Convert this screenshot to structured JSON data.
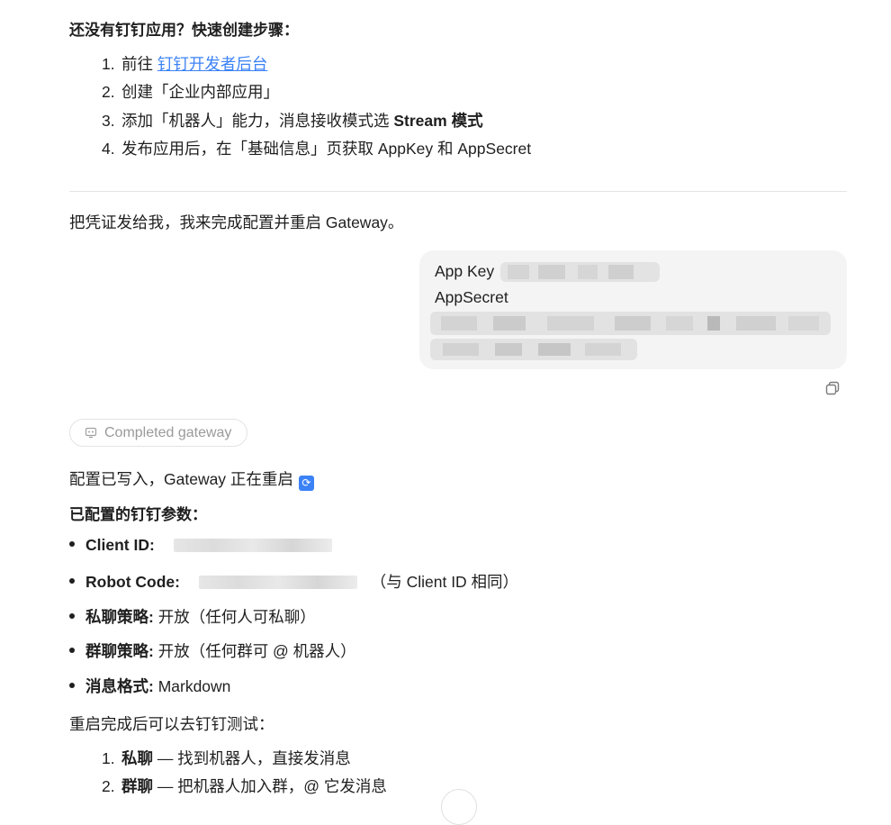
{
  "guide": {
    "heading": "还没有钉钉应用？快速创建步骤：",
    "steps": [
      {
        "num": "1.",
        "prefix": "前往 ",
        "link": "钉钉开发者后台",
        "rest": ""
      },
      {
        "num": "2.",
        "prefix": "创建「企业内部应用」",
        "link": "",
        "rest": ""
      },
      {
        "num": "3.",
        "prefix": "添加「机器人」能力，消息接收模式选 ",
        "bold": "Stream 模式",
        "rest": ""
      },
      {
        "num": "4.",
        "prefix": "发布应用后，在「基础信息」页获取 AppKey 和 AppSecret",
        "link": "",
        "rest": ""
      }
    ]
  },
  "assistant_prompt": "把凭证发给我，我来完成配置并重启 Gateway。",
  "user_message": {
    "line1_label": "App Key",
    "line2_label": "AppSecret"
  },
  "tool_pill": {
    "label": "Completed gateway",
    "icon": "robot-icon"
  },
  "result": {
    "status_text": "配置已写入，Gateway 正在重启",
    "status_icon": "refresh-icon",
    "params_heading": "已配置的钉钉参数：",
    "params": [
      {
        "key": "Client ID:",
        "value": "",
        "note": ""
      },
      {
        "key": "Robot Code:",
        "value": "",
        "note": "（与 Client ID 相同）"
      },
      {
        "key": "私聊策略:",
        "value": " 开放（任何人可私聊）",
        "note": ""
      },
      {
        "key": "群聊策略:",
        "value": " 开放（任何群可 @ 机器人）",
        "note": ""
      },
      {
        "key": "消息格式:",
        "value": " Markdown",
        "note": ""
      }
    ],
    "test_heading": "重启完成后可以去钉钉测试：",
    "tests": [
      {
        "num": "1.",
        "key": "私聊",
        "text": " — 找到机器人，直接发消息"
      },
      {
        "num": "2.",
        "key": "群聊",
        "text": " — 把机器人加入群，@ 它发消息"
      }
    ]
  },
  "colors": {
    "link": "#3b82f6",
    "bubble_bg": "#f4f4f4",
    "pill_text": "#9a9a9a"
  }
}
